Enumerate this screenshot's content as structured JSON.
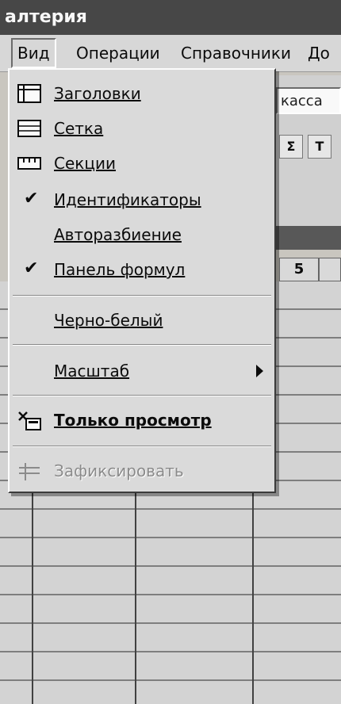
{
  "title": "алтерия",
  "menubar": [
    {
      "label": "Вид",
      "open": true
    },
    {
      "label": "Операции"
    },
    {
      "label": "Справочники"
    },
    {
      "label": "До"
    }
  ],
  "toolbar": {
    "combo_value": "касса"
  },
  "table": {
    "header_cell": "5"
  },
  "menu": {
    "items": [
      {
        "label": "Заголовки",
        "icon": "headers-icon"
      },
      {
        "label": "Сетка",
        "icon": "grid-icon"
      },
      {
        "label": "Секции",
        "icon": "sections-icon"
      },
      {
        "label": "Идентификаторы",
        "checked": true
      },
      {
        "label": "Авторазбиение"
      },
      {
        "label": "Панель формул",
        "checked": true
      },
      {
        "label": "Черно-белый"
      },
      {
        "label": "Масштаб",
        "submenu": true
      },
      {
        "label": "Только просмотр",
        "icon": "readonly-icon"
      },
      {
        "label": "Зафиксировать",
        "icon": "freeze-icon",
        "disabled": true
      }
    ]
  }
}
